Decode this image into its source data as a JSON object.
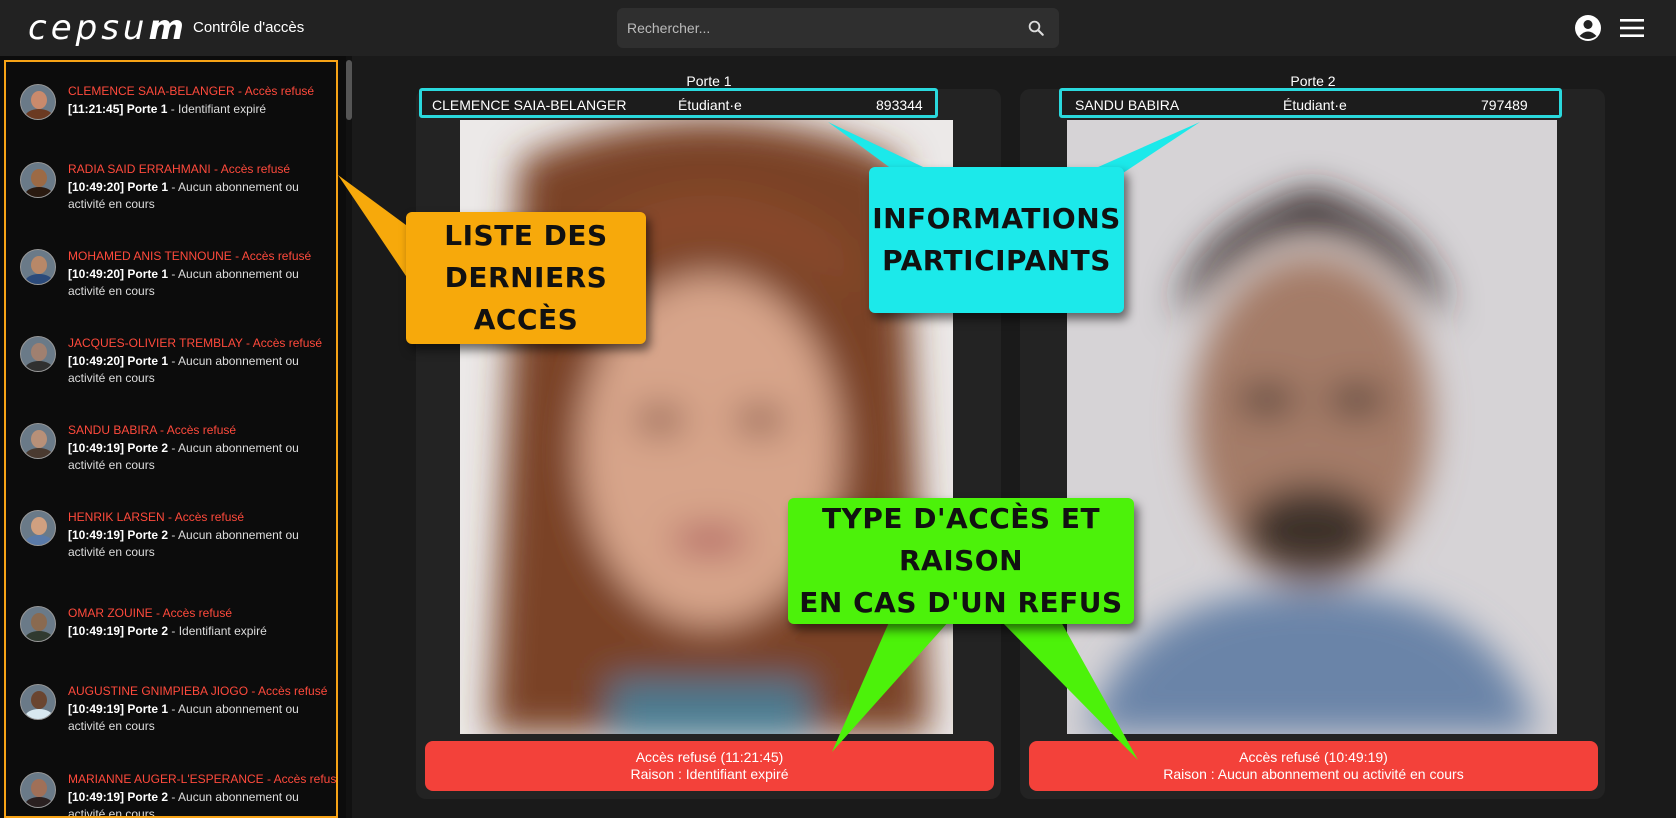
{
  "header": {
    "logo_text_light": "cepsu",
    "logo_text_bold": "m",
    "title": "Contrôle d'accès",
    "search_placeholder": "Rechercher...",
    "icons": [
      "search-icon",
      "account-icon",
      "menu-icon"
    ]
  },
  "recent_access": [
    {
      "name": "CLEMENCE SAIA-BELANGER - Accès refusé",
      "time": "[11:21:45] Porte 1",
      "reason": " - Identifiant expiré",
      "avatar_skin": "#c98a6c",
      "avatar_hair": "#6b3a22"
    },
    {
      "name": "RADIA SAID ERRAHMANI - Accès refusé",
      "time": "[10:49:20] Porte 1",
      "reason": " - Aucun abonnement ou activité en cours",
      "avatar_skin": "#9c6a45",
      "avatar_hair": "#2a1a10"
    },
    {
      "name": "MOHAMED ANIS TENNOUNE - Accès refusé",
      "time": "[10:49:20] Porte 1",
      "reason": " - Aucun abonnement ou activité en cours",
      "avatar_skin": "#b88868",
      "avatar_hair": "#2b4a7a"
    },
    {
      "name": "JACQUES-OLIVIER TREMBLAY - Accès refusé",
      "time": "[10:49:20] Porte 1",
      "reason": " - Aucun abonnement ou activité en cours",
      "avatar_skin": "#a08070",
      "avatar_hair": "#303030"
    },
    {
      "name": "SANDU BABIRA - Accès refusé",
      "time": "[10:49:19] Porte 2",
      "reason": " - Aucun abonnement ou activité en cours",
      "avatar_skin": "#b89078",
      "avatar_hair": "#4a3a30"
    },
    {
      "name": "HENRIK LARSEN - Accès refusé",
      "time": "[10:49:19] Porte 2",
      "reason": " - Aucun abonnement ou activité en cours",
      "avatar_skin": "#d0a080",
      "avatar_hair": "#5a7aa8"
    },
    {
      "name": "OMAR ZOUINE - Accès refusé",
      "time": "[10:49:19] Porte 2",
      "reason": " - Identifiant expiré",
      "avatar_skin": "#8a6a50",
      "avatar_hair": "#303a30"
    },
    {
      "name": "AUGUSTINE GNIMPIEBA JIOGO - Accès refusé",
      "time": "[10:49:19] Porte 1",
      "reason": " - Aucun abonnement ou activité en cours",
      "avatar_skin": "#6a4530",
      "avatar_hair": "#d8e8f0"
    },
    {
      "name": "MARIANNE AUGER-L'ESPERANCE - Accès refusé",
      "time": "[10:49:19] Porte 2",
      "reason": " - Aucun abonnement ou activité en cours",
      "avatar_skin": "#a07058",
      "avatar_hair": "#2a2020"
    }
  ],
  "doors": [
    {
      "label": "Porte 1",
      "participant_name": "CLEMENCE SAIA-BELANGER",
      "participant_type": "Étudiant·e",
      "participant_id": "893344",
      "status_line": "Accès refusé (11:21:45)",
      "reason_line": "Raison : Identifiant expiré"
    },
    {
      "label": "Porte 2",
      "participant_name": "SANDU BABIRA",
      "participant_type": "Étudiant·e",
      "participant_id": "797489",
      "status_line": "Accès refusé (10:49:19)",
      "reason_line": "Raison : Aucun abonnement ou activité en cours"
    }
  ],
  "callouts": {
    "list": "LISTE DES\nDERNIERS ACCÈS",
    "info": "INFORMATIONS\nPARTICIPANTS",
    "type": "TYPE D'ACCÈS ET RAISON\nEN CAS D'UN REFUS"
  },
  "colors": {
    "list_frame": "#f7a316",
    "info_frame": "#2ad9dd",
    "refused": "#f3413a",
    "callout_orange": "#f7a90b",
    "callout_cyan": "#1ce9ea",
    "callout_green": "#4cf20a"
  }
}
